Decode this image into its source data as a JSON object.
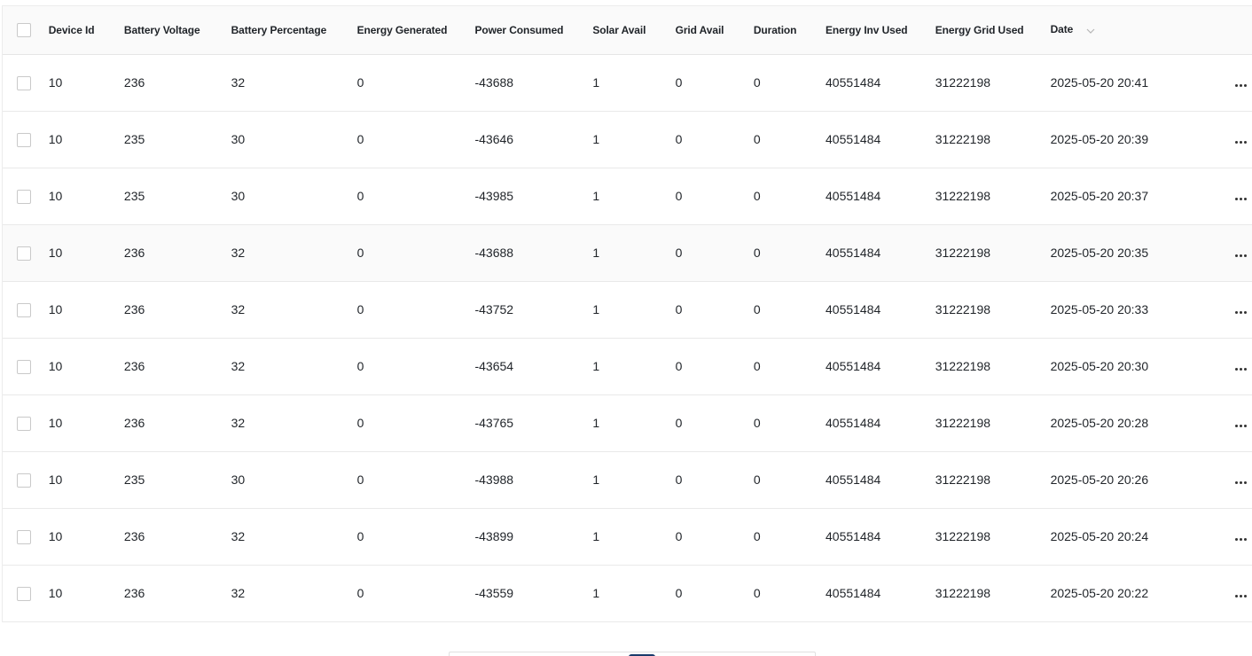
{
  "table": {
    "columns": [
      "Device Id",
      "Battery Voltage",
      "Battery Percentage",
      "Energy Generated",
      "Power Consumed",
      "Solar Avail",
      "Grid Avail",
      "Duration",
      "Energy Inv Used",
      "Energy Grid Used",
      "Date"
    ],
    "sort_icon": "chevron-down-icon",
    "row_action_icon": "more-horizontal-icon",
    "rows": [
      [
        "10",
        "236",
        "32",
        "0",
        "-43688",
        "1",
        "0",
        "0",
        "40551484",
        "31222198",
        "2025-05-20 20:41"
      ],
      [
        "10",
        "235",
        "30",
        "0",
        "-43646",
        "1",
        "0",
        "0",
        "40551484",
        "31222198",
        "2025-05-20 20:39"
      ],
      [
        "10",
        "235",
        "30",
        "0",
        "-43985",
        "1",
        "0",
        "0",
        "40551484",
        "31222198",
        "2025-05-20 20:37"
      ],
      [
        "10",
        "236",
        "32",
        "0",
        "-43688",
        "1",
        "0",
        "0",
        "40551484",
        "31222198",
        "2025-05-20 20:35"
      ],
      [
        "10",
        "236",
        "32",
        "0",
        "-43752",
        "1",
        "0",
        "0",
        "40551484",
        "31222198",
        "2025-05-20 20:33"
      ],
      [
        "10",
        "236",
        "32",
        "0",
        "-43654",
        "1",
        "0",
        "0",
        "40551484",
        "31222198",
        "2025-05-20 20:30"
      ],
      [
        "10",
        "236",
        "32",
        "0",
        "-43765",
        "1",
        "0",
        "0",
        "40551484",
        "31222198",
        "2025-05-20 20:28"
      ],
      [
        "10",
        "235",
        "30",
        "0",
        "-43988",
        "1",
        "0",
        "0",
        "40551484",
        "31222198",
        "2025-05-20 20:26"
      ],
      [
        "10",
        "236",
        "32",
        "0",
        "-43899",
        "1",
        "0",
        "0",
        "40551484",
        "31222198",
        "2025-05-20 20:24"
      ],
      [
        "10",
        "236",
        "32",
        "0",
        "-43559",
        "1",
        "0",
        "0",
        "40551484",
        "31222198",
        "2025-05-20 20:22"
      ]
    ]
  },
  "pagination": {
    "active_color": "#1a3b6b"
  }
}
